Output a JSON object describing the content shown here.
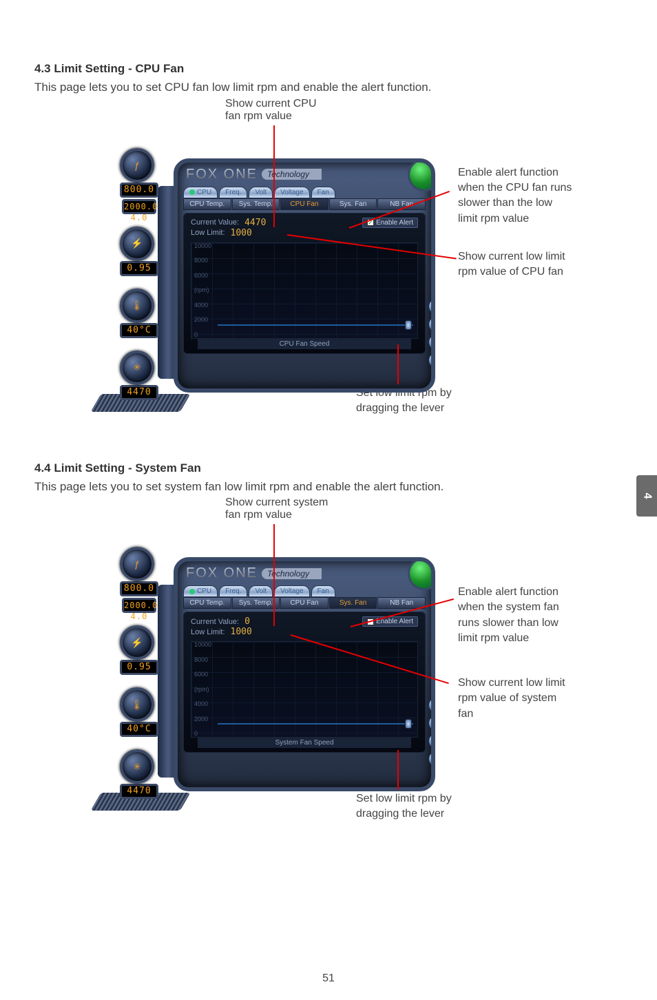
{
  "page_number": "51",
  "side_tab": "4",
  "sections": [
    {
      "heading": "4.3 Limit Setting - CPU Fan",
      "desc": "This page lets you to set CPU fan low limit rpm and enable the alert function.",
      "captions": {
        "top_line1": "Show current CPU",
        "top_line2": "fan rpm value",
        "right1a": "Enable alert function",
        "right1b": "when the CPU fan runs",
        "right1c": "slower than the low",
        "right1d": "limit rpm value",
        "right2a": "Show current low limit",
        "right2b": "rpm value of CPU fan",
        "bottom1": "Set low limit rpm by",
        "bottom2": "dragging the lever"
      },
      "ui": {
        "brand": "FOX ONE",
        "brand_sub": "Technology",
        "tabs": [
          "CPU",
          "Freq.",
          "Volt",
          "Voltage",
          "Fan"
        ],
        "subtabs": [
          "CPU Temp.",
          "Sys. Temp.",
          "CPU Fan",
          "Sys. Fan",
          "NB Fan"
        ],
        "active_subtab_index": 2,
        "current_label": "Current Value:",
        "lowlimit_label": "Low Limit:",
        "current_value": "4470",
        "lowlimit_value": "1000",
        "enable_label": "Enable Alert",
        "unit": "(rpm)",
        "yscale": [
          "10000",
          "8000",
          "6000",
          "4000",
          "2000",
          "0"
        ],
        "chart_title": "CPU Fan Speed",
        "left_lcds": [
          "800.0",
          "2000.0 4.0",
          "0.95",
          "40°C",
          "4470"
        ]
      }
    },
    {
      "heading": "4.4 Limit Setting - System Fan",
      "desc": "This page lets you to set system fan low limit rpm and enable the alert function.",
      "captions": {
        "top_line1": "Show current system",
        "top_line2": "fan rpm value",
        "right1a": "Enable alert function",
        "right1b": "when the system fan",
        "right1c": "runs slower than low",
        "right1d": "limit rpm value",
        "right2a": "Show current low limit",
        "right2b": "rpm value of system",
        "right2c": "fan",
        "bottom1": "Set low limit rpm by",
        "bottom2": "dragging the lever"
      },
      "ui": {
        "brand": "FOX ONE",
        "brand_sub": "Technology",
        "tabs": [
          "CPU",
          "Freq.",
          "Volt",
          "Voltage",
          "Fan"
        ],
        "subtabs": [
          "CPU Temp.",
          "Sys. Temp.",
          "CPU Fan",
          "Sys. Fan",
          "NB Fan"
        ],
        "active_subtab_index": 3,
        "current_label": "Current Value:",
        "lowlimit_label": "Low Limit:",
        "current_value": "0",
        "lowlimit_value": "1000",
        "enable_label": "Enable Alert",
        "unit": "(rpm)",
        "yscale": [
          "10000",
          "8000",
          "6000",
          "4000",
          "2000",
          "0"
        ],
        "chart_title": "System Fan Speed",
        "left_lcds": [
          "800.0",
          "2000.0 4.0",
          "0.95",
          "40°C",
          "4470"
        ]
      }
    }
  ]
}
